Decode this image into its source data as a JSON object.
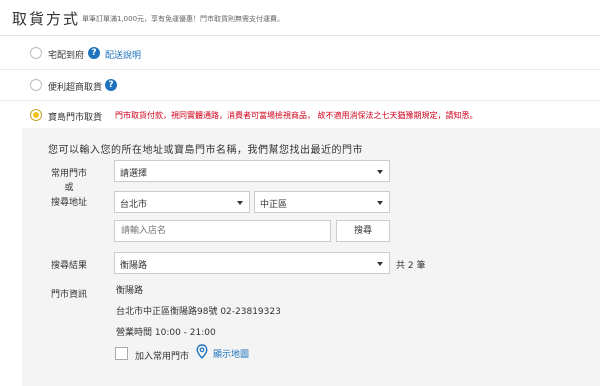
{
  "header": {
    "title": "取貨方式",
    "subtitle": "單筆訂單滿1,000元，享有免運優惠！門市取貨則無需支付運費。"
  },
  "options": {
    "home_delivery": {
      "label": "宅配到府",
      "link": "配送說明"
    },
    "convenience_store": {
      "label": "便利超商取貨"
    },
    "bao_store": {
      "label": "寶島門市取貨",
      "notice": "門市取貨付款，視同實體通路，消費者可當場檢視商品，  故不適用消保法之七天猶豫期規定，請知悉。"
    }
  },
  "store_pickup": {
    "intro": "您可以輸入您的所在地址或寶島門市名稱，我們幫您找出最近的門市",
    "labels": {
      "common_store": "常用門市",
      "or": "或",
      "search_address": "搜尋地址",
      "search_result": "搜尋結果",
      "store_info": "門市資訊"
    },
    "common_store_select": "請選擇",
    "city_select": "台北市",
    "district_select": "中正區",
    "store_name_placeholder": "請輸入店名",
    "search_button": "搜尋",
    "result_select": "衡陽路",
    "result_count": "共 2 筆",
    "store": {
      "name": "衡陽路",
      "address": "台北市中正區衡陽路98號 02-23819323",
      "hours": "營業時間 10:00 - 21:00"
    },
    "add_common_label": "加入常用門市",
    "map_link": "顯示地圖"
  },
  "colors": {
    "accent_blue": "#1e73be",
    "warning_red": "#d0021b",
    "radio_yellow": "#f0c419",
    "panel_bg": "#f4f4f4"
  },
  "icons": {
    "help": "question-circle-icon",
    "map": "map-pin-icon",
    "caret": "chevron-down-icon"
  }
}
